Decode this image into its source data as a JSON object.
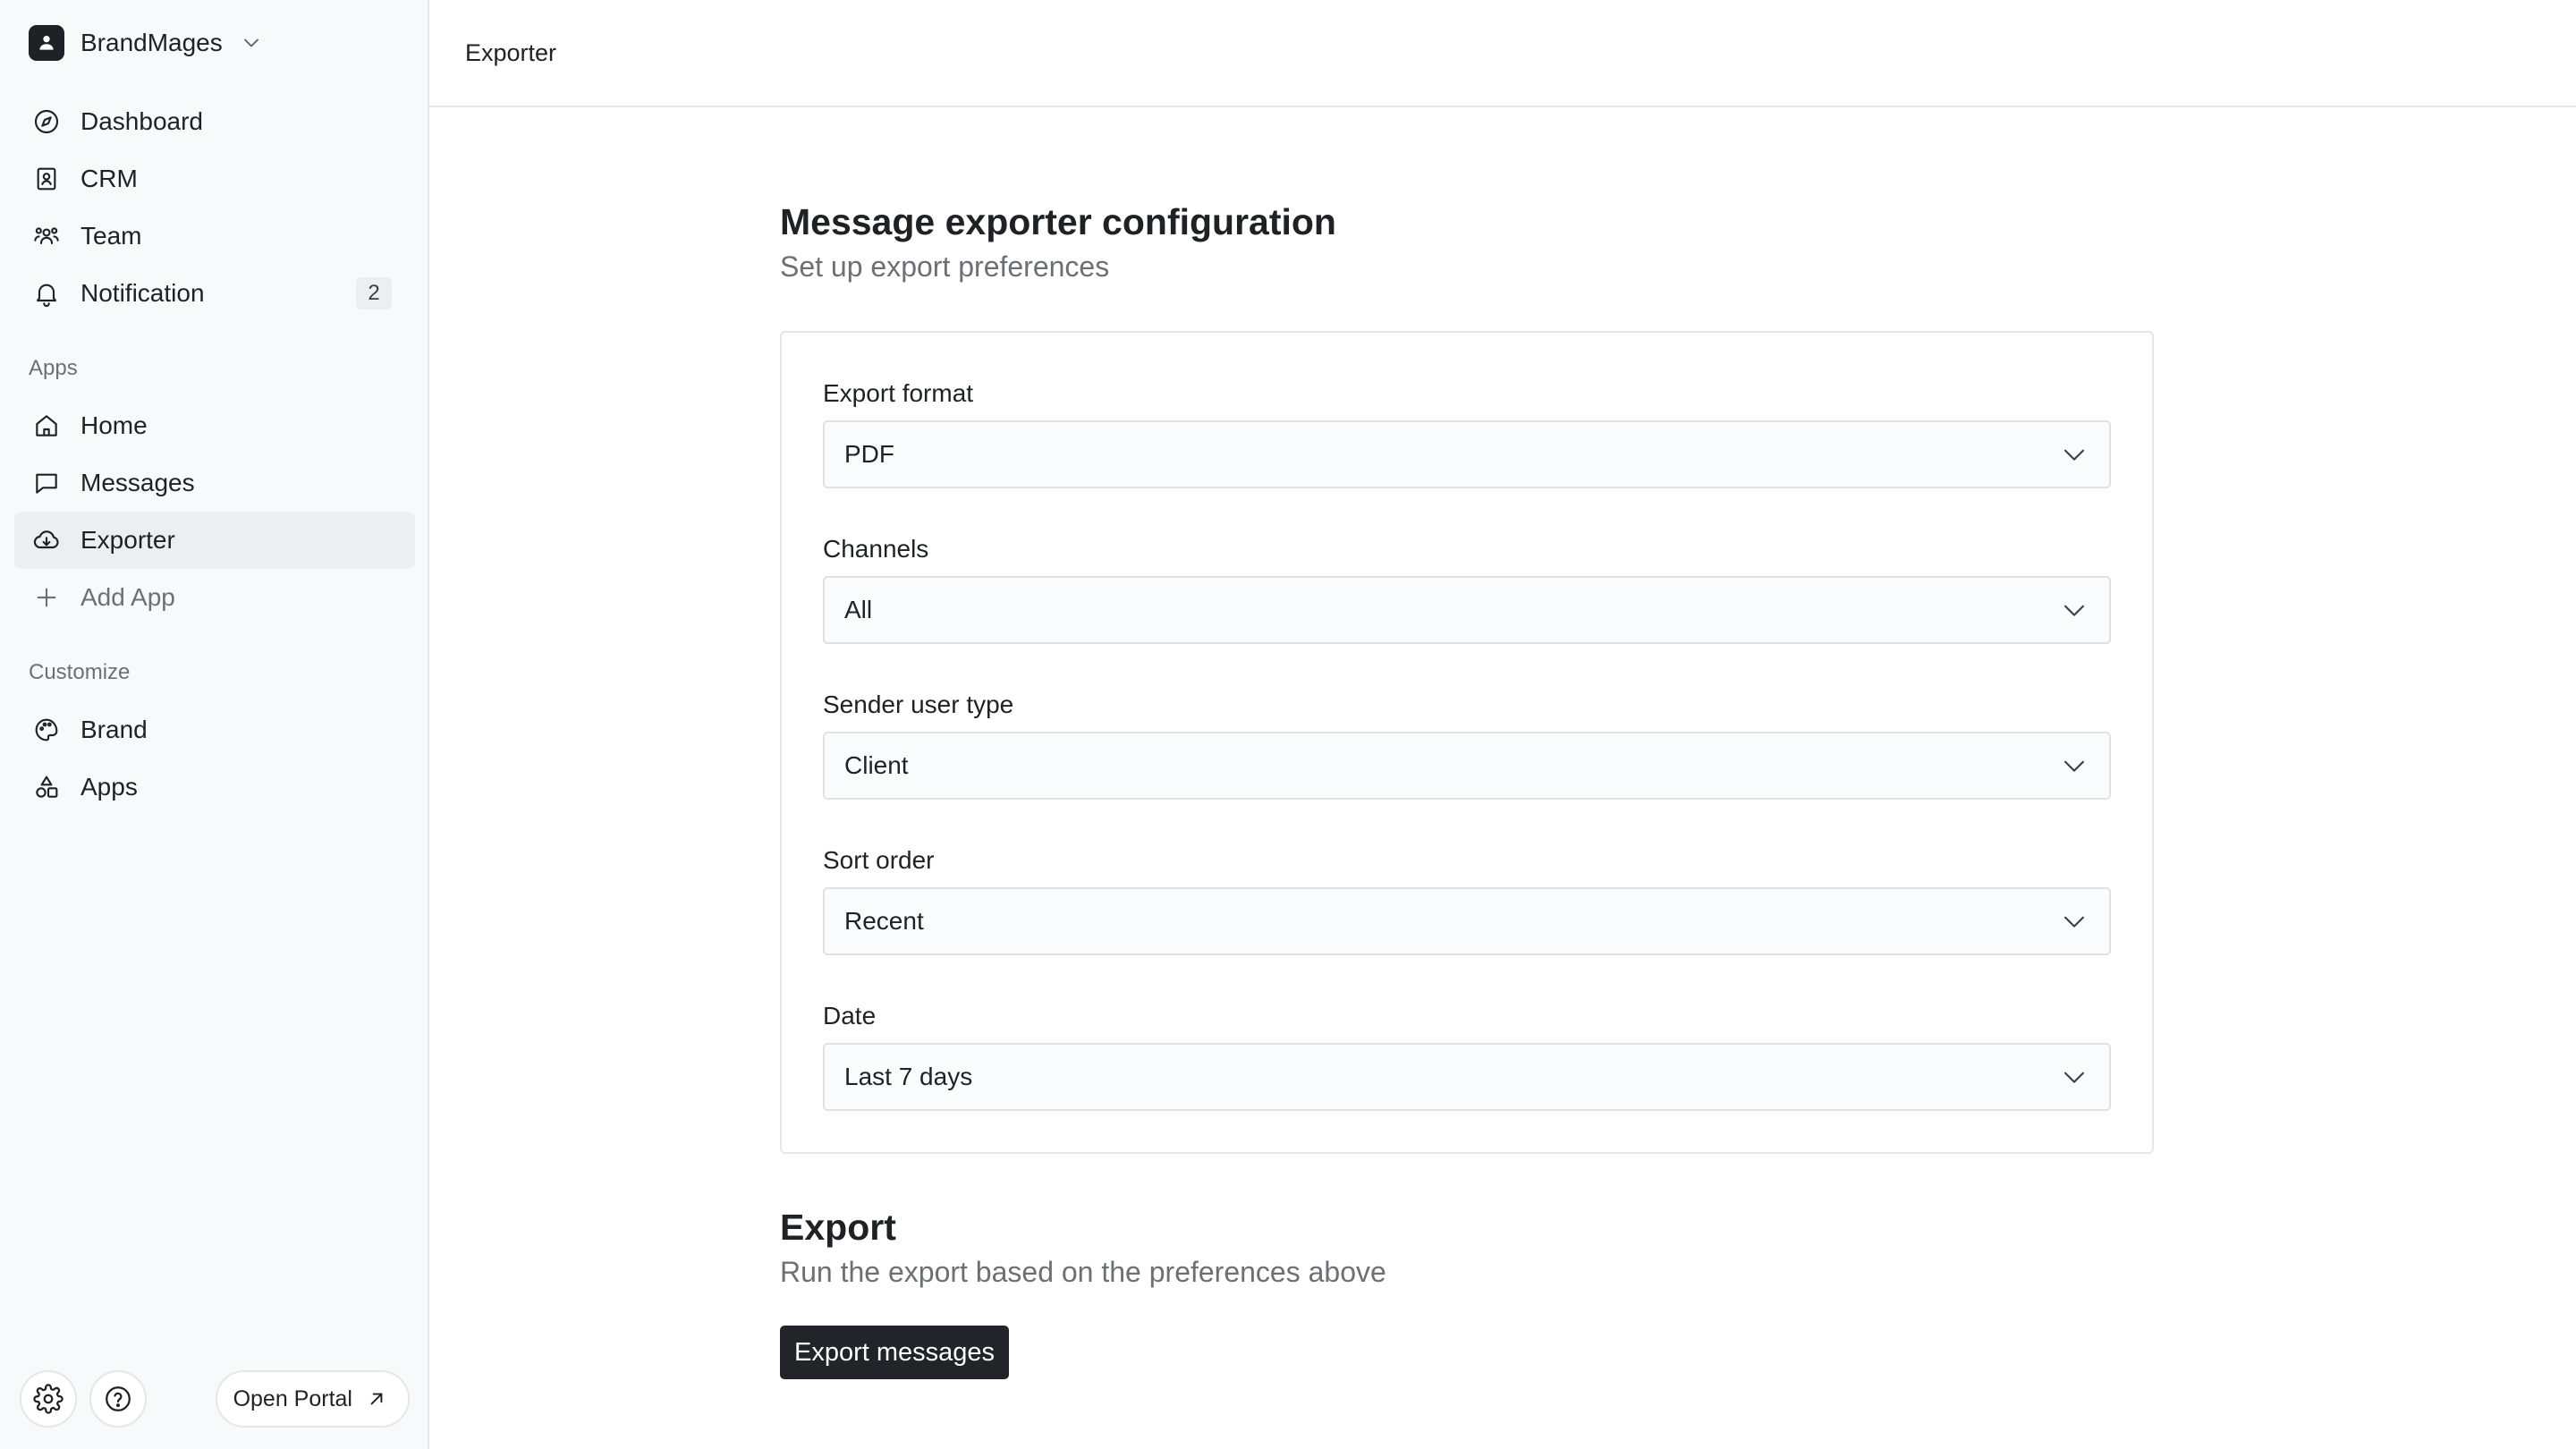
{
  "workspace": {
    "name": "BrandMages",
    "icon": "contact-card-icon"
  },
  "nav": {
    "main": [
      {
        "label": "Dashboard",
        "icon": "compass-icon"
      },
      {
        "label": "CRM",
        "icon": "contact-book-icon"
      },
      {
        "label": "Team",
        "icon": "team-icon"
      },
      {
        "label": "Notification",
        "icon": "bell-icon",
        "badge": "2"
      }
    ],
    "apps_label": "Apps",
    "apps": [
      {
        "label": "Home",
        "icon": "home-icon"
      },
      {
        "label": "Messages",
        "icon": "message-icon"
      },
      {
        "label": "Exporter",
        "icon": "cloud-download-icon",
        "active": true
      },
      {
        "label": "Add App",
        "icon": "plus-icon"
      }
    ],
    "customize_label": "Customize",
    "customize": [
      {
        "label": "Brand",
        "icon": "palette-icon"
      },
      {
        "label": "Apps",
        "icon": "shapes-icon"
      }
    ]
  },
  "footer": {
    "settings_icon": "gear-icon",
    "help_icon": "help-circle-icon",
    "portal_label": "Open Portal",
    "portal_icon": "arrow-up-right-icon"
  },
  "header": {
    "breadcrumb": "Exporter"
  },
  "config": {
    "title": "Message exporter configuration",
    "subtitle": "Set up export preferences",
    "fields": [
      {
        "label": "Export format",
        "value": "PDF"
      },
      {
        "label": "Channels",
        "value": "All"
      },
      {
        "label": "Sender user type",
        "value": "Client"
      },
      {
        "label": "Sort order",
        "value": "Recent"
      },
      {
        "label": "Date",
        "value": "Last 7 days"
      }
    ]
  },
  "export": {
    "title": "Export",
    "subtitle": "Run the export based on the preferences above",
    "button_label": "Export messages"
  },
  "colors": {
    "sidebar_bg": "#f8f9fa",
    "active_item_bg": "#eceef0",
    "primary_button": "#212529",
    "border": "#e4e6e9",
    "muted_text": "#6c7076"
  }
}
